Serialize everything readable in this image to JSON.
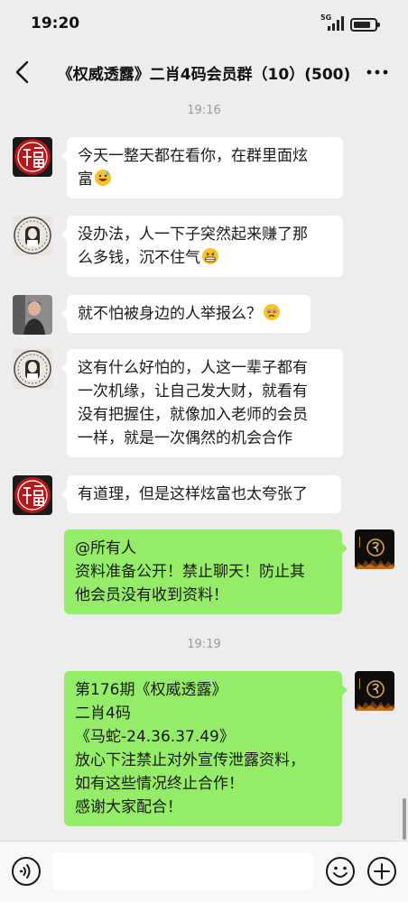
{
  "status": {
    "time": "19:20",
    "network": "5G"
  },
  "header": {
    "title": "《权威透露》二肖4码会员群（10）(500)"
  },
  "timestamps": {
    "first": "19:16",
    "second": "19:19"
  },
  "messages": [
    {
      "side": "left",
      "avatar": "fu-seal-avatar",
      "lines": [
        "今天一整天都在看你，在群里面炫",
        "富"
      ],
      "emoji": "sweat-smile-emoji"
    },
    {
      "side": "left",
      "avatar": "portrait-seal-avatar",
      "lines": [
        "没办法，人一下子突然起来赚了那",
        "么多钱，沉不住气"
      ],
      "emoji": "grin-emoji"
    },
    {
      "side": "left",
      "avatar": "person-photo-avatar",
      "lines": [
        "就不怕被身边的人举报么？"
      ],
      "emoji": "worried-face-emoji"
    },
    {
      "side": "left",
      "avatar": "portrait-seal-avatar",
      "lines": [
        "这有什么好怕的，人这一辈子都有",
        "一次机缘，让自己发大财，就看有",
        "没有把握住，就像加入老师的会员",
        "一样，就是一次偶然的机会合作"
      ]
    },
    {
      "side": "left",
      "avatar": "fu-seal-avatar",
      "lines": [
        "有道理，但是这样炫富也太夸张了"
      ]
    },
    {
      "side": "right",
      "avatar": "dark-logo-avatar",
      "lines": [
        "@所有人",
        "资料准备公开！禁止聊天！防止其",
        "他会员没有收到资料！"
      ]
    },
    {
      "side": "right",
      "avatar": "dark-logo-avatar",
      "lines": [
        "第176期《权威透露》",
        "二肖4码",
        "《马蛇-24.36.37.49》",
        "放心下注禁止对外宣传泄露资料，",
        "如有这些情况终止合作！",
        "感谢大家配合！"
      ]
    }
  ],
  "input": {
    "placeholder": ""
  },
  "colors": {
    "background": "#ededed",
    "incoming_bubble": "#ffffff",
    "outgoing_bubble": "#95ec69",
    "seal_red": "#b5171b"
  }
}
